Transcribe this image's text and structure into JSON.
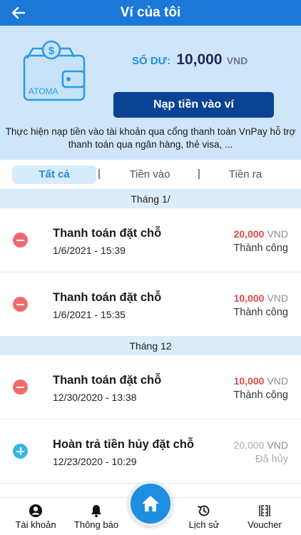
{
  "header": {
    "title": "Ví của tôi"
  },
  "wallet": {
    "logo_text": "ATOMA",
    "balance_label": "SỐ DƯ:",
    "balance_amount": "10,000",
    "balance_unit": "VND",
    "topup_label": "Nạp tiền vào ví",
    "topup_description": "Thực hiện nạp tiền vào tài khoản qua cổng thanh toán VnPay hỗ trợ thanh toán qua ngân hàng, thẻ visa, ..."
  },
  "tabs": [
    {
      "label": "Tất cả",
      "active": true
    },
    {
      "label": "Tiền vào",
      "active": false
    },
    {
      "label": "Tiền ra",
      "active": false
    }
  ],
  "tab_separator": "|",
  "groups": [
    {
      "month": "Tháng 1/",
      "transactions": [
        {
          "type": "minus",
          "title": "Thanh toán đặt chỗ",
          "datetime": "1/6/2021 - 15:39",
          "amount": "20,000",
          "currency": "VND",
          "status": "Thành công"
        },
        {
          "type": "minus",
          "title": "Thanh toán đặt chỗ",
          "datetime": "1/6/2021 - 15:35",
          "amount": "10,000",
          "currency": "VND",
          "status": "Thành công"
        }
      ]
    },
    {
      "month": "Tháng 12",
      "transactions": [
        {
          "type": "minus",
          "title": "Thanh toán đặt chỗ",
          "datetime": "12/30/2020 - 13:38",
          "amount": "10,000",
          "currency": "VND",
          "status": "Thành công"
        },
        {
          "type": "plus",
          "title": "Hoàn trả tiền hủy đặt chỗ",
          "datetime": "12/23/2020 - 10:29",
          "amount": "20,000",
          "currency": "VND",
          "status": "Đã hủy"
        }
      ]
    }
  ],
  "colors": {
    "primary": "#1b78d6",
    "panel": "#cfe6fa",
    "button": "#0a4394",
    "negative": "#e04848",
    "positive": "#35b5e2"
  },
  "bottom_nav": [
    {
      "label": "Tài khoản",
      "icon": "account-icon"
    },
    {
      "label": "Thông báo",
      "icon": "bell-icon"
    },
    {
      "label": "",
      "icon": "home-icon"
    },
    {
      "label": "Lịch sử",
      "icon": "history-icon"
    },
    {
      "label": "Voucher",
      "icon": "voucher-icon"
    }
  ]
}
